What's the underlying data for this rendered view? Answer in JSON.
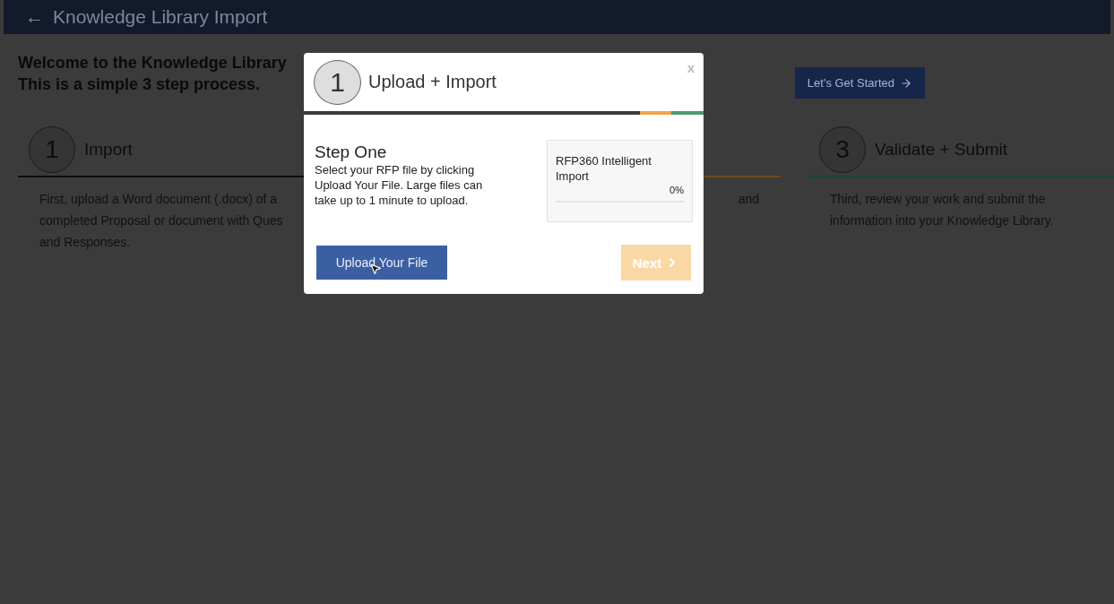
{
  "header": {
    "back_icon": "←",
    "title": "Knowledge Library Import"
  },
  "intro": {
    "lines": [
      "Welcome to the Knowledge Library",
      "This is a simple 3 step process."
    ],
    "button": "Let's Get Started"
  },
  "steps": [
    {
      "number": "1",
      "title": "Import",
      "description_lines": [
        "First, upload a Word document (.docx) of a",
        "completed Proposal or document with Ques",
        "and Responses."
      ],
      "color": "#0d0d0d"
    },
    {
      "description_lines": [
        "and"
      ],
      "color": "#6b4a1e"
    },
    {
      "number": "3",
      "title": "Validate + Submit",
      "description_lines": [
        "Third, review your work and submit the",
        "information into your Knowledge Library."
      ],
      "color": "#1f4436"
    }
  ],
  "modal": {
    "step_number": "1",
    "title": "Upload + Import",
    "close": "x",
    "heading": "Step One",
    "text": "Select your RFP file by clicking Upload Your File. Large files can take up to 1 minute to upload.",
    "progress": {
      "label": "RFP360 Intelligent Import",
      "reading": "0%",
      "level": 0
    },
    "upload_button": "Upload Your File",
    "next_button": {
      "label": "Next",
      "disabled": true
    }
  }
}
